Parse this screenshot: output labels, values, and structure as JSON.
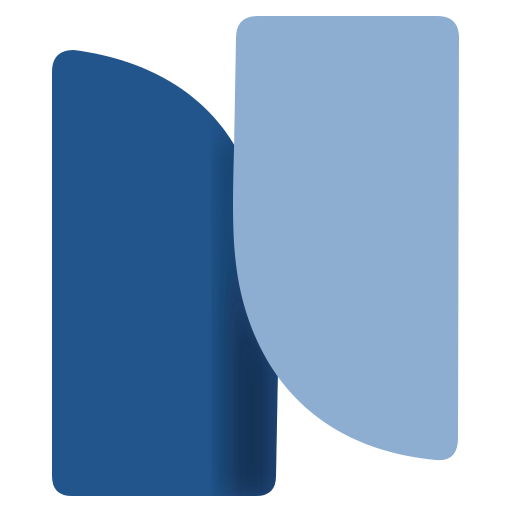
{
  "logo": {
    "icon_name": "app-logo-icon",
    "colors": {
      "background": "#ffffff",
      "dark_panel": "#22558c",
      "light_panel": "#8dadd1",
      "shadow": "#0c223d"
    }
  }
}
